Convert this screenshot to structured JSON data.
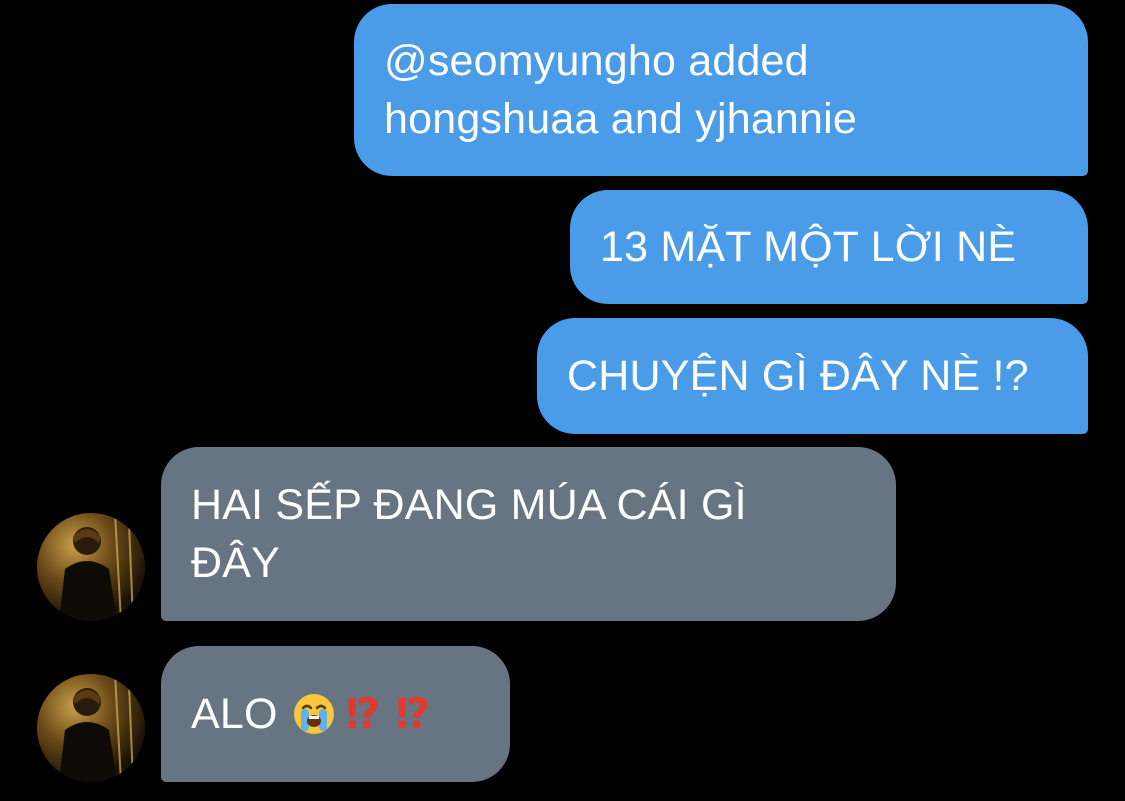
{
  "colors": {
    "background": "#000000",
    "sent_bubble": "#4a9be8",
    "received_bubble": "#677482",
    "exclamation": "#e03a2e"
  },
  "messages": [
    {
      "direction": "sent",
      "text": "@seomyungho added hongshuaa and yjhannie"
    },
    {
      "direction": "sent",
      "text": "13 MẶT MỘT LỜI NÈ"
    },
    {
      "direction": "sent",
      "text": "CHUYỆN GÌ ĐÂY NÈ !?"
    },
    {
      "direction": "received",
      "text": "HAI SẾP ĐANG MÚA CÁI GÌ ĐÂY"
    },
    {
      "direction": "received",
      "text": "ALO",
      "emoji": "loudly-crying-face-icon",
      "marks": [
        "⁉",
        "⁉"
      ]
    }
  ]
}
